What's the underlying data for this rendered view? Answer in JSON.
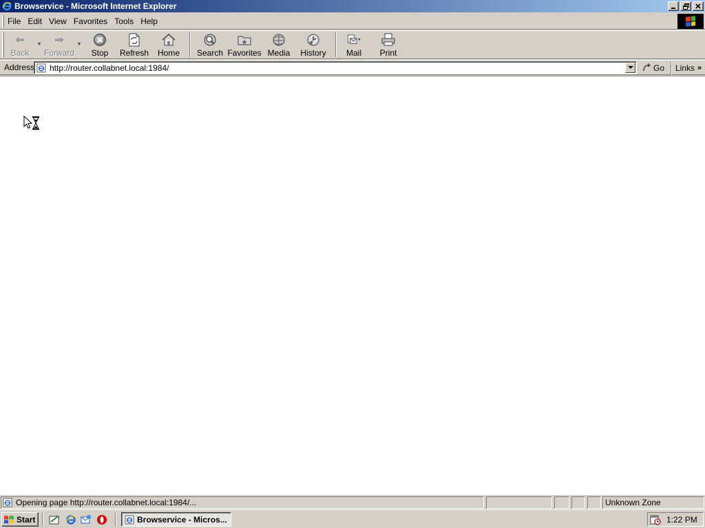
{
  "window": {
    "title": "Browservice - Microsoft Internet Explorer"
  },
  "menu": {
    "items": [
      "File",
      "Edit",
      "View",
      "Favorites",
      "Tools",
      "Help"
    ]
  },
  "toolbar": {
    "buttons": [
      {
        "label": "Back",
        "icon": "back-arrow-icon",
        "enabled": false
      },
      {
        "label": "Forward",
        "icon": "forward-arrow-icon",
        "enabled": false
      },
      {
        "label": "Stop",
        "icon": "stop-icon",
        "enabled": true
      },
      {
        "label": "Refresh",
        "icon": "refresh-icon",
        "enabled": true
      },
      {
        "label": "Home",
        "icon": "home-icon",
        "enabled": true
      },
      {
        "label": "Search",
        "icon": "search-icon",
        "enabled": true
      },
      {
        "label": "Favorites",
        "icon": "favorites-icon",
        "enabled": true
      },
      {
        "label": "Media",
        "icon": "media-icon",
        "enabled": true
      },
      {
        "label": "History",
        "icon": "history-icon",
        "enabled": true
      },
      {
        "label": "Mail",
        "icon": "mail-icon",
        "enabled": true
      },
      {
        "label": "Print",
        "icon": "print-icon",
        "enabled": true
      }
    ]
  },
  "address": {
    "label": "Address",
    "url": "http://router.collabnet.local:1984/",
    "go_label": "Go",
    "links_label": "Links"
  },
  "status": {
    "text": "Opening page http://router.collabnet.local:1984/...",
    "zone": "Unknown Zone"
  },
  "taskbar": {
    "start_label": "Start",
    "task_label": "Browservice - Micros...",
    "clock": "1:22 PM"
  },
  "colors": {
    "titlebar_start": "#0a246a",
    "titlebar_end": "#a6caf0",
    "chrome": "#d4d0c8"
  }
}
